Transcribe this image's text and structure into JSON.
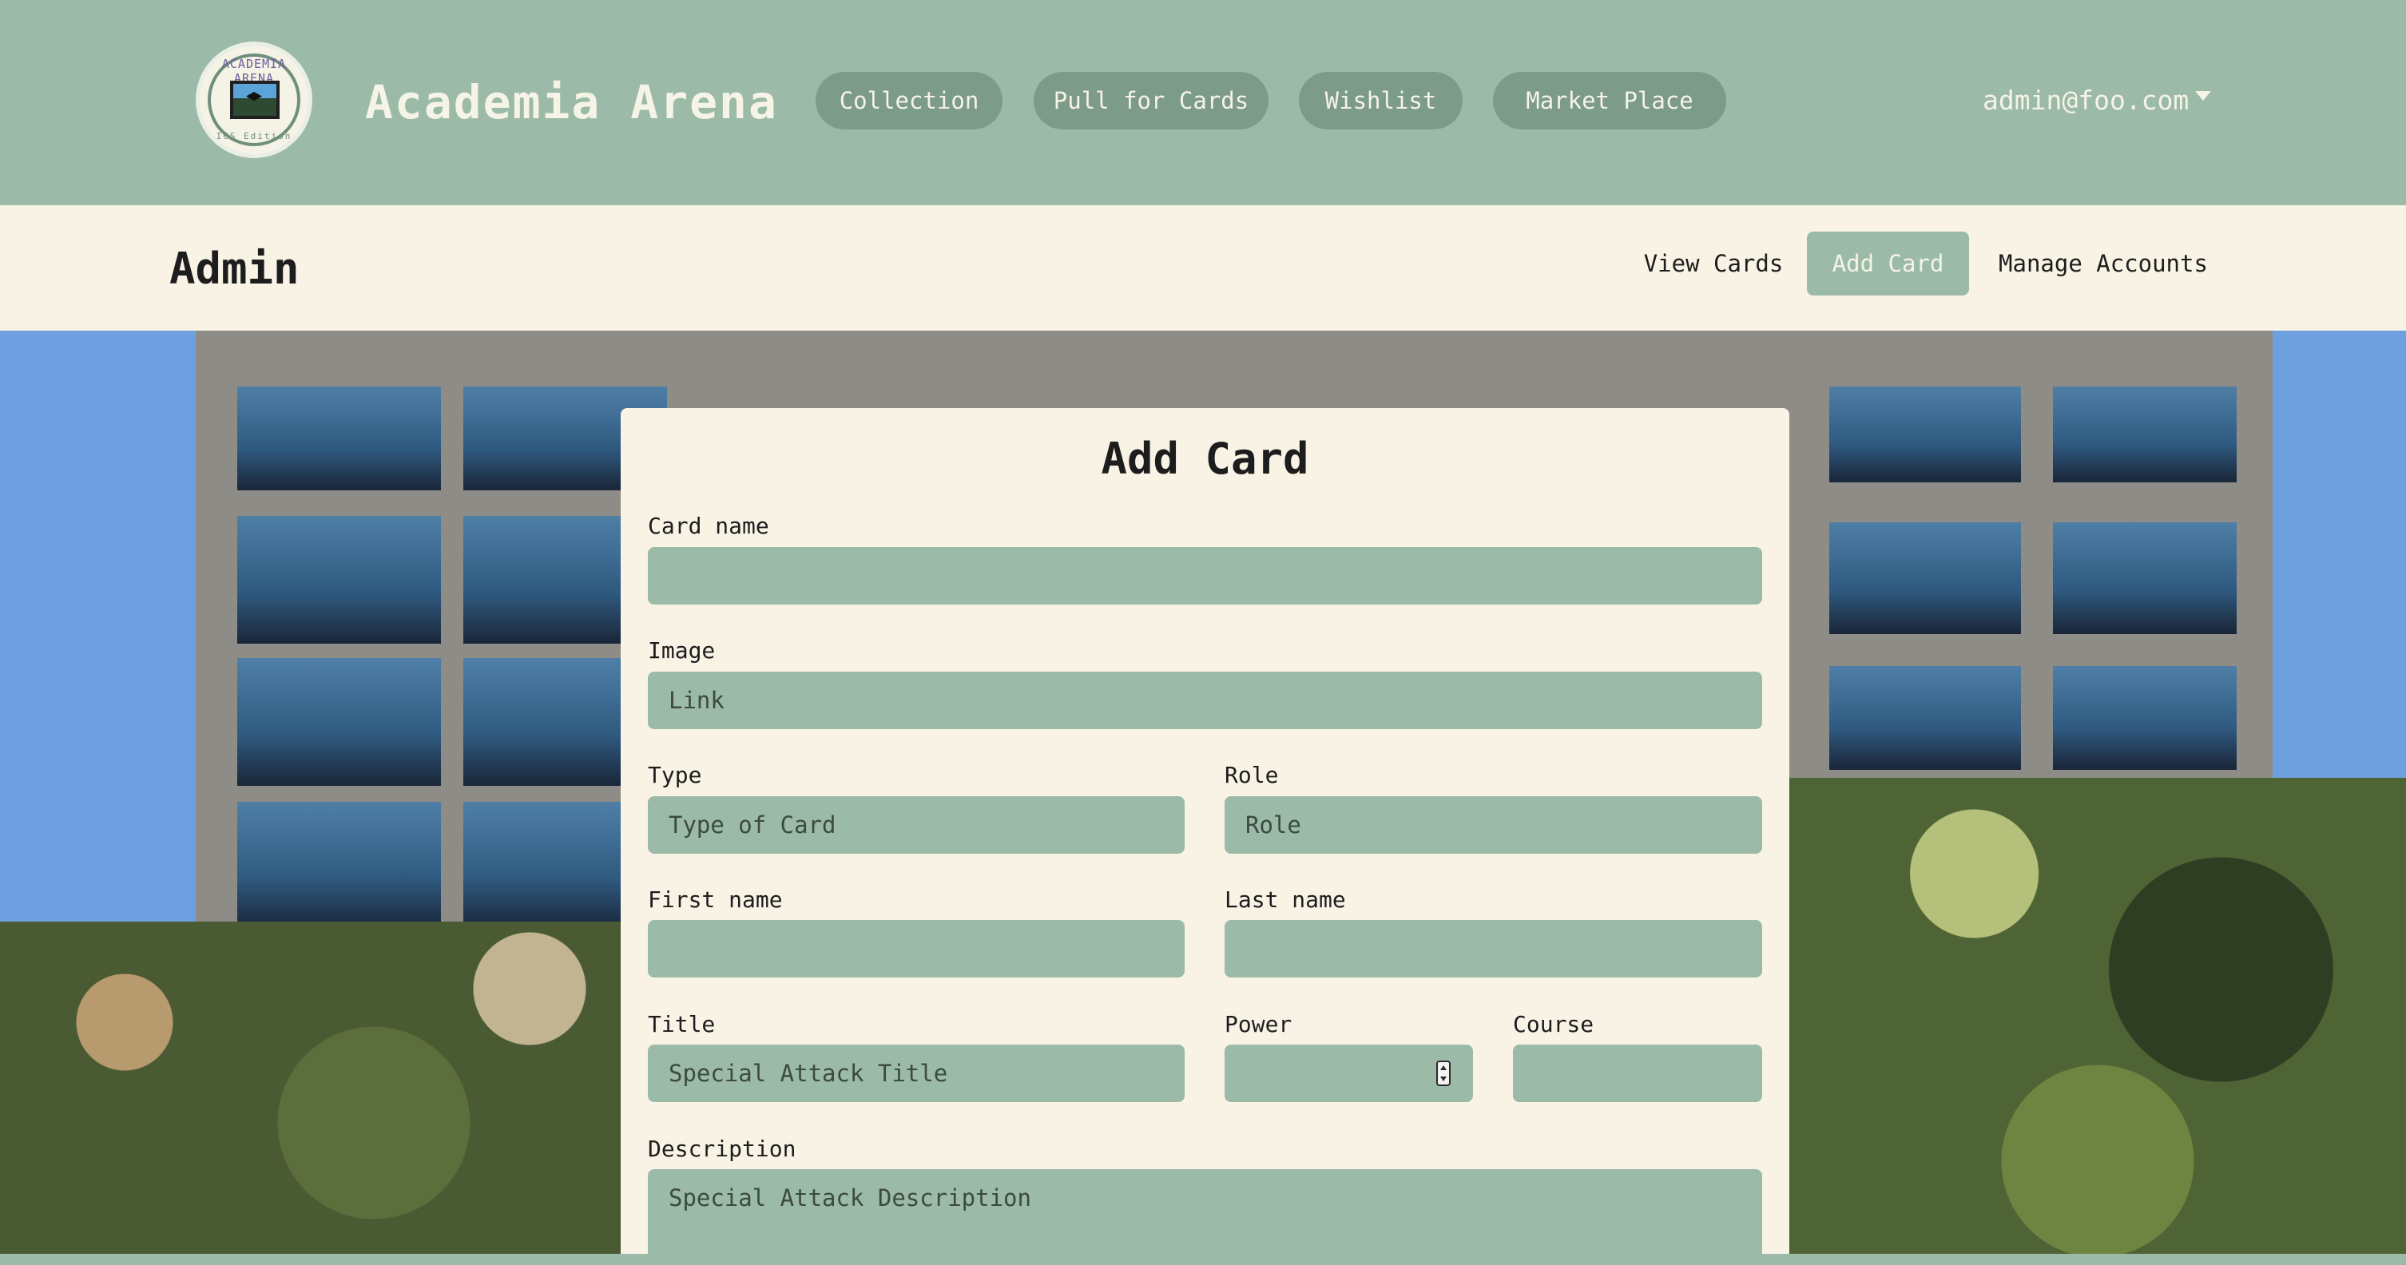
{
  "navbar": {
    "logo_text_top": "ACADEMIA ARENA",
    "logo_text_bottom": "ICS Edition",
    "brand": "Academia Arena",
    "links": [
      "Collection",
      "Pull for Cards",
      "Wishlist",
      "Market Place"
    ],
    "user": "admin@foo.com"
  },
  "admin_bar": {
    "title": "Admin",
    "links": [
      "View Cards",
      "Add Card",
      "Manage Accounts"
    ],
    "active": "Add Card"
  },
  "form": {
    "title": "Add Card",
    "card_name": {
      "label": "Card name",
      "placeholder": ""
    },
    "image": {
      "label": "Image",
      "placeholder": "Link"
    },
    "type": {
      "label": "Type",
      "placeholder": "Type of Card"
    },
    "role": {
      "label": "Role",
      "placeholder": "Role"
    },
    "first_name": {
      "label": "First name",
      "placeholder": ""
    },
    "last_name": {
      "label": "Last name",
      "placeholder": ""
    },
    "title_field": {
      "label": "Title",
      "placeholder": "Special Attack Title"
    },
    "power": {
      "label": "Power",
      "placeholder": ""
    },
    "course": {
      "label": "Course",
      "placeholder": ""
    },
    "description": {
      "label": "Description",
      "placeholder": "Special Attack Description"
    }
  },
  "colors": {
    "sage": "#9cbaa8",
    "cream": "#f8f3e5",
    "pill": "#7c9b89",
    "text_dark": "#1d1d1d"
  }
}
